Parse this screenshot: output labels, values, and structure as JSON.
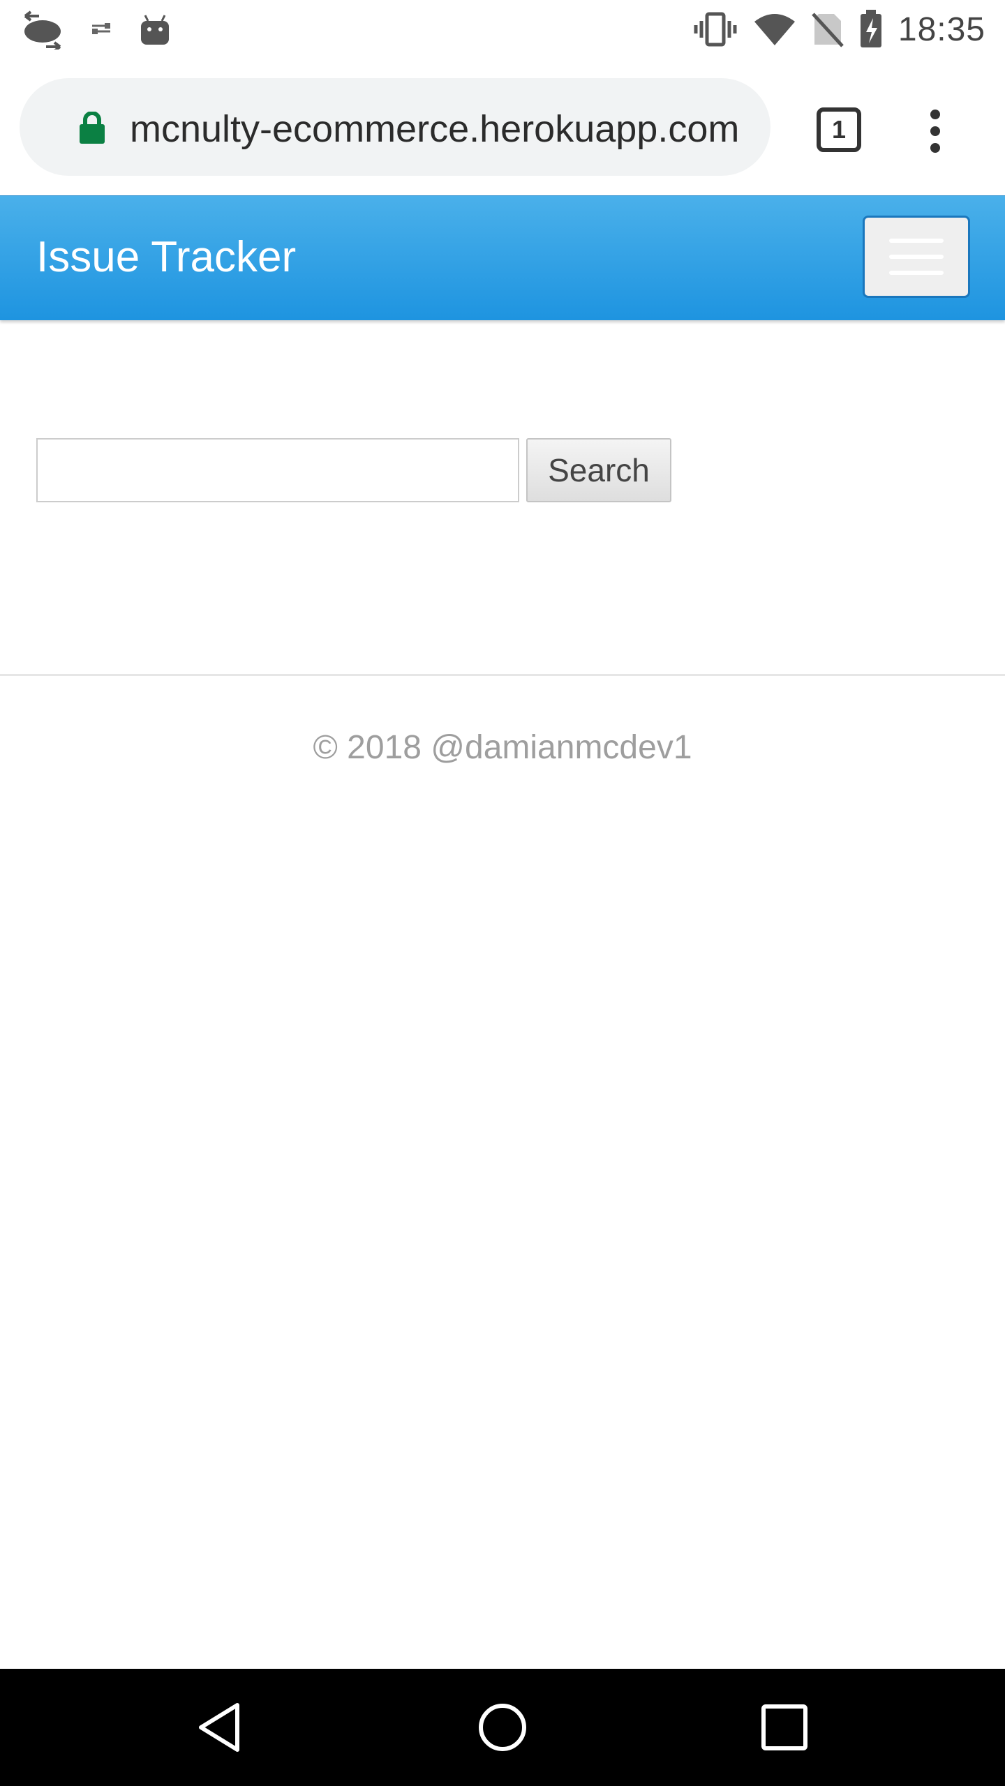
{
  "status_bar": {
    "time": "18:35",
    "left_icons": [
      "sync-arrows-icon",
      "usb-debug-icon",
      "android-icon"
    ],
    "right_icons": [
      "vibrate-icon",
      "wifi-icon",
      "no-sim-icon",
      "battery-charging-icon"
    ]
  },
  "browser": {
    "url": "mcnulty-ecommerce.herokuapp.com",
    "tab_count": "1",
    "secure": true,
    "lock_color": "#0b8043"
  },
  "navbar": {
    "brand": "Issue Tracker",
    "background": "#2196F3"
  },
  "search": {
    "input_value": "",
    "button_label": "Search"
  },
  "footer": {
    "text": "© 2018 @damianmcdev1"
  },
  "system_nav": {
    "buttons": [
      "back-icon",
      "home-icon",
      "recents-icon"
    ]
  }
}
